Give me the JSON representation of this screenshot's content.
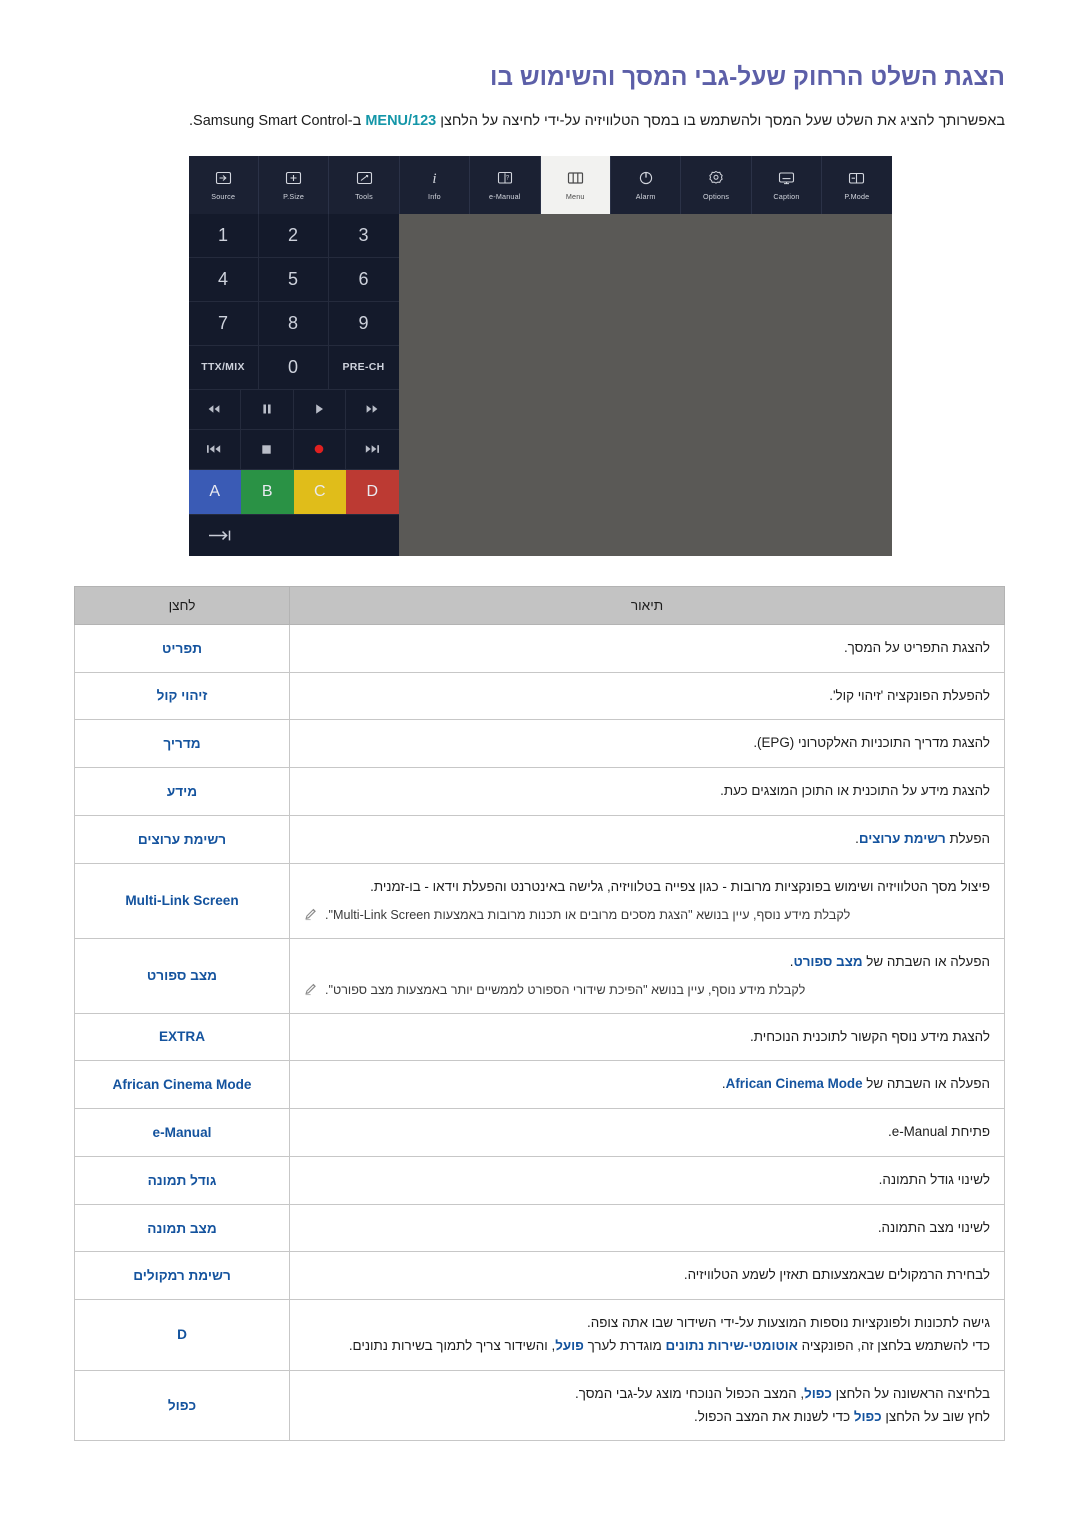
{
  "document": {
    "title": "הצגת השלט הרחוק שעל-גבי המסך והשימוש בו",
    "intro_part1": "באפשרותך להציג את השלט שעל המסך ולהשתמש בו במסך הטלוויזיה על-ידי לחיצה על הלחצן",
    "intro_button": "MENU/123",
    "intro_part2": "ב-Samsung Smart Control."
  },
  "remote": {
    "toolbar": [
      {
        "label": "Source",
        "icon": "source-icon",
        "active": false
      },
      {
        "label": "P.Size",
        "icon": "picture-size-icon",
        "active": false
      },
      {
        "label": "Tools",
        "icon": "tools-icon",
        "active": false
      },
      {
        "label": "Info",
        "icon": "info-icon",
        "active": false
      },
      {
        "label": "e-Manual",
        "icon": "e-manual-icon",
        "active": false
      },
      {
        "label": "Menu",
        "icon": "menu-icon",
        "active": true
      },
      {
        "label": "Alarm",
        "icon": "alarm-power-icon",
        "active": false
      },
      {
        "label": "Options",
        "icon": "options-gear-icon",
        "active": false
      },
      {
        "label": "Caption",
        "icon": "caption-icon",
        "active": false
      },
      {
        "label": "P.Mode",
        "icon": "picture-mode-icon",
        "active": false
      }
    ],
    "keypad": [
      "1",
      "2",
      "3",
      "4",
      "5",
      "6",
      "7",
      "8",
      "9",
      "TTX/MIX",
      "0",
      "PRE-CH"
    ],
    "media_row1": [
      "rewind-icon",
      "pause-icon",
      "play-icon",
      "fast-forward-icon"
    ],
    "media_row2": [
      "previous-track-icon",
      "stop-icon",
      "record-icon",
      "next-track-icon"
    ],
    "color_buttons": [
      {
        "label": "A",
        "color": "#3a5bb5"
      },
      {
        "label": "B",
        "color": "#2a9245"
      },
      {
        "label": "C",
        "color": "#e0bd1a"
      },
      {
        "label": "D",
        "color": "#bc3a33"
      }
    ],
    "exit_icon": "exit-arrow-icon"
  },
  "table": {
    "headers": {
      "description": "תיאור",
      "button": "לחצן"
    },
    "rows": [
      {
        "button": "תפריט",
        "desc": "להצגת התפריט על המסך."
      },
      {
        "button": "זיהוי קול",
        "desc": "להפעלת הפונקציה 'זיהוי קול'."
      },
      {
        "button": "מדריך",
        "desc": "להצגת מדריך התוכניות האלקטרוני (EPG)."
      },
      {
        "button": "מידע",
        "desc": "להצגת מידע על התוכנית או התוכן המוצגים כעת."
      },
      {
        "button": "רשימת ערוצים",
        "desc_pre": "הפעלת ",
        "desc_hl": "רשימת ערוצים",
        "desc_post": "."
      },
      {
        "button": "Multi-Link Screen",
        "button_ltr": true,
        "desc": "פיצול מסך הטלוויזיה ושימוש בפונקציות מרובות - כגון צפייה בטלוויזיה, גלישה באינטרנט והפעלת וידאו - בו-זמנית.",
        "note": "לקבלת מידע נוסף, עיין בנושא \"הצגת מסכים מרובים או תכנות מרובות באמצעות Multi-Link Screen\"."
      },
      {
        "button": "מצב ספורט",
        "desc_pre": "הפעלה או השבתה של ",
        "desc_hl": "מצב ספורט",
        "desc_post": ".",
        "note": "לקבלת מידע נוסף, עיין בנושא \"הפיכת שידורי הספורט לממשיים יותר באמצעות מצב ספורט\"."
      },
      {
        "button": "EXTRA",
        "button_ltr": true,
        "desc": "להצגת מידע נוסף הקשור לתוכנית הנוכחית."
      },
      {
        "button": "African Cinema Mode",
        "button_ltr": true,
        "desc_pre": "הפעלה או השבתה של ",
        "desc_hl": "African Cinema Mode",
        "desc_hl_ltr": true,
        "desc_post": "."
      },
      {
        "button": "e-Manual",
        "button_ltr": true,
        "desc_pre": "פתיחת ",
        "desc_hl_plain": "e-Manual",
        "desc_post": "."
      },
      {
        "button": "גודל תמונה",
        "desc": "לשינוי גודל התמונה."
      },
      {
        "button": "מצב תמונה",
        "desc": "לשינוי מצב התמונה."
      },
      {
        "button": "רשימת רמקולים",
        "desc": "לבחירת הרמקולים שבאמצעותם תאזין לשמע הטלוויזיה."
      },
      {
        "button": "D",
        "button_ltr": true,
        "desc_line1": "גישה לתכונות ולפונקציות נוספות המוצעות על-ידי השידור שבו אתה צופה.",
        "desc_line2_pre": "כדי להשתמש בלחצן זה, הפונקציה ",
        "desc_line2_hl1": "אוטומטי-שירות נתונים",
        "desc_line2_mid": " מוגדרת לערך ",
        "desc_line2_hl2": "פועל",
        "desc_line2_post": ", והשידור צריך לתמוך בשירות נתונים."
      },
      {
        "button": "כפול",
        "desc_line1_pre": "בלחיצה הראשונה על הלחצן ",
        "desc_line1_hl": "כפול",
        "desc_line1_post": ", המצב הכפול הנוכחי מוצג על-גבי המסך.",
        "desc_line2_pre": "לחץ שוב על הלחצן ",
        "desc_line2_hl": "כפול",
        "desc_line2_post": " כדי לשנות את המצב הכפול."
      }
    ]
  }
}
